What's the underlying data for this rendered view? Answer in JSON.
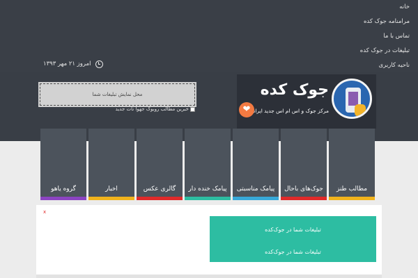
{
  "nav": {
    "items": [
      {
        "label": "خانه"
      },
      {
        "label": "مرامنامه جوک کده"
      },
      {
        "label": "تماس با ما"
      },
      {
        "label": "تبلیغات در جوک کده"
      },
      {
        "label": "ناحیه کاربری"
      }
    ],
    "date_text": "امروز ۲۱ مهر ۱۳۹۳",
    "clock_icon": "clock-icon"
  },
  "logo": {
    "title": "جوک کده",
    "subtitle": "مرکز جوک و اس ام اس جدید ایرانیان",
    "heart_icon": "heart-icon"
  },
  "ad": {
    "placeholder": "محل نمایش تبلیغات شما"
  },
  "feed": {
    "label": "خبرین مطالب روبوک جهوا نات جدید",
    "icon": "feed-icon"
  },
  "tiles": [
    {
      "label": "مطالب طنز",
      "color": "#f1b31c"
    },
    {
      "label": "جوک‌های باحال",
      "color": "#e02a2a"
    },
    {
      "label": "پیامک مناسبتی",
      "color": "#38a9d9"
    },
    {
      "label": "پیامک خنده دار",
      "color": "#2dbda2"
    },
    {
      "label": "گالری عکس",
      "color": "#e02a2a"
    },
    {
      "label": "اخبار",
      "color": "#f1b31c"
    },
    {
      "label": "گروه یاهو",
      "color": "#8b44c1"
    }
  ],
  "content": {
    "close_mark": "x",
    "buttons": [
      {
        "label": "تبلیغات شما در جوک‌کده"
      },
      {
        "label": "تبلیغات شما در جوک‌کده"
      }
    ]
  },
  "colors": {
    "topbar_bg": "#3a3f47",
    "tile_bg": "#4c535c",
    "accent_green": "#2dbda2"
  }
}
